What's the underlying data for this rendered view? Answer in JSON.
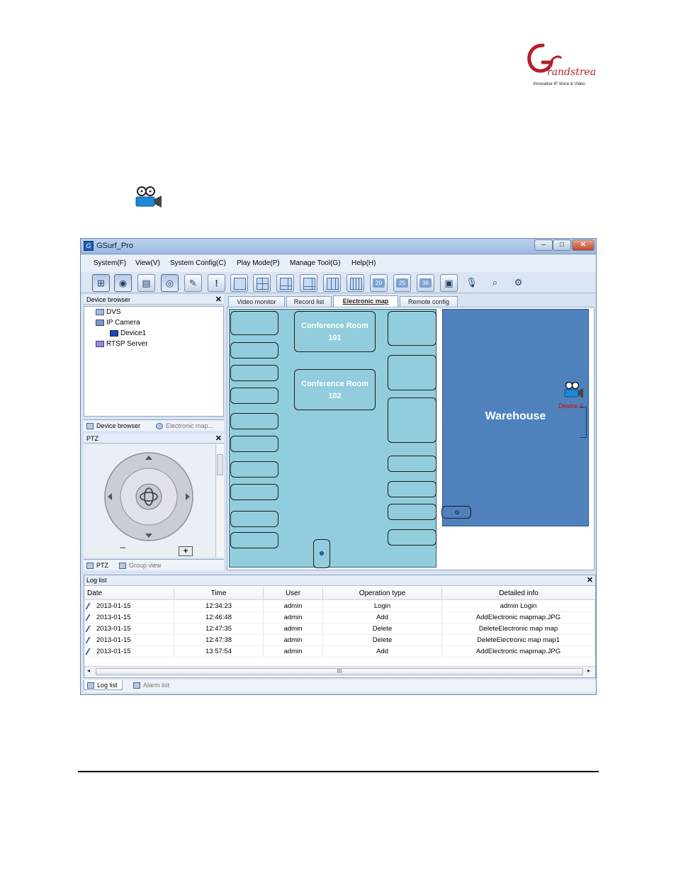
{
  "logo": {
    "text": "Grandstream",
    "tagline": "Innovative IP Voice & Video",
    "color": "#b3202a"
  },
  "window": {
    "title": "GSurf_Pro",
    "controls": {
      "minimize": "–",
      "maximize": "□",
      "close": "✕"
    }
  },
  "menu": [
    "System(F)",
    "View(V)",
    "System Config(C)",
    "Play Mode(P)",
    "Manage Tool(G)",
    "Help(H)"
  ],
  "toolbar": {
    "tools": [
      "device-tree",
      "globe",
      "monitor",
      "ptz",
      "record",
      "alarm"
    ],
    "layouts": [
      "1",
      "4",
      "6",
      "8",
      "9",
      "16"
    ],
    "numbered_layouts": [
      "20",
      "25",
      "36"
    ],
    "extra": [
      "snapshot",
      "microphone",
      "search",
      "config"
    ]
  },
  "device_browser": {
    "title": "Device browser",
    "close": "✕",
    "tree": [
      "DVS",
      "IP Camera",
      "Device1",
      "RTSP Server"
    ],
    "tabs": [
      "Device browser",
      "Electronic map..."
    ]
  },
  "ptz": {
    "title": "PTZ",
    "close": "✕",
    "zoom_in": "+",
    "tabs": [
      "PTZ",
      "Group view"
    ]
  },
  "main_tabs": [
    "Video monitor",
    "Record list",
    "Electronic map",
    "Remote config"
  ],
  "map": {
    "rooms": [
      {
        "label": "Conference Room 101"
      },
      {
        "label": "Conference Room 102"
      }
    ],
    "warehouse": "Warehouse",
    "device_label": "Device 1",
    "colors": {
      "floor": "#92cddd",
      "warehouse": "#4f81bd",
      "device_label": "#e00000"
    }
  },
  "log": {
    "title": "Log list",
    "close": "✕",
    "columns": [
      "Date",
      "Time",
      "User",
      "Operation type",
      "Detailed info"
    ],
    "rows": [
      [
        "2013-01-15",
        "12:34:23",
        "admin",
        "Login",
        "admin Login"
      ],
      [
        "2013-01-15",
        "12:46:48",
        "admin",
        "Add",
        "AddElectronic mapmap.JPG"
      ],
      [
        "2013-01-15",
        "12:47:35",
        "admin",
        "Delete",
        "DeleteElectronic map map"
      ],
      [
        "2013-01-15",
        "12:47:38",
        "admin",
        "Delete",
        "DeleteElectronic map map1"
      ],
      [
        "2013-01-15",
        "13:57:54",
        "admin",
        "Add",
        "AddElectronic mapmap.JPG"
      ]
    ],
    "scroll_grip": "III",
    "tabs": [
      "Log list",
      "Alarm list"
    ]
  }
}
